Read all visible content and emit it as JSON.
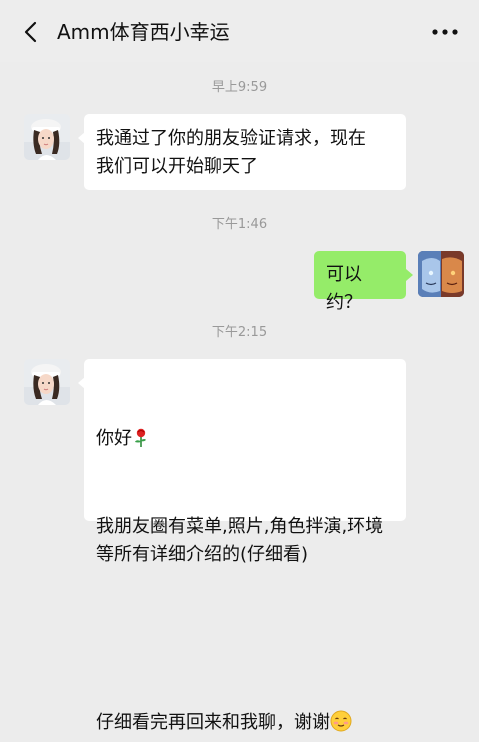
{
  "header": {
    "title": "Amm体育西小幸运",
    "back_icon": "chevron-left-icon",
    "more_icon": "more-dots-icon"
  },
  "messages": [
    {
      "kind": "time",
      "text": "早上9:59"
    },
    {
      "kind": "message",
      "side": "left",
      "text": "我通过了你的朋友验证请求，现在\n我们可以开始聊天了"
    },
    {
      "kind": "time",
      "text": "下午1:46"
    },
    {
      "kind": "message",
      "side": "right",
      "text": "可以约？"
    },
    {
      "kind": "time",
      "text": "下午2:15"
    },
    {
      "kind": "message",
      "side": "left",
      "line1": "你好",
      "line1_icon": "rose-icon",
      "body": "我朋友圈有菜单,照片,角色拌演,环境\n等所有详细介绍的(仔细看)",
      "last_line": "仔细看完再回来和我聊，谢谢",
      "last_icon": "blushing-face-icon"
    }
  ],
  "colors": {
    "background": "#ececec",
    "bubble_left": "#ffffff",
    "bubble_right": "#95ec69",
    "timestamp": "#999999"
  }
}
